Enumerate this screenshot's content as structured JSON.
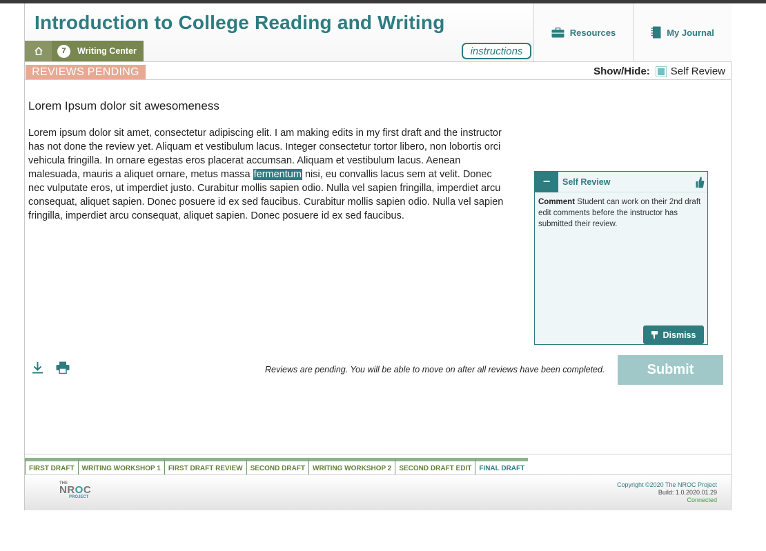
{
  "header": {
    "title": "Introduction to College Reading and Writing",
    "breadcrumb": {
      "step_number": "7",
      "section": "Writing Center"
    },
    "instructions_label": "instructions",
    "resources_label": "Resources",
    "journal_label": "My Journal"
  },
  "status": {
    "badge": "REVIEWS PENDING",
    "show_hide_label": "Show/Hide:",
    "self_review_toggle_label": "Self Review",
    "self_review_checked": true
  },
  "document": {
    "title": "Lorem Ipsum dolor sit awesomeness",
    "body_before": "Lorem ipsum dolor sit amet, consectetur adipiscing elit. I am making edits in my first draft and the instructor has not done the review yet. Aliquam et vestibulum lacus. Integer consectetur tortor libero, non lobortis orci vehicula fringilla. In ornare egestas eros placerat accumsan. Aliquam et vestibulum lacus. Aenean malesuada, mauris a aliquet ornare, metus massa ",
    "highlighted": "fermentum",
    "body_after": " nisi, eu convallis lacus sem at velit. Donec nec vulputate eros, ut imperdiet justo. Curabitur mollis sapien odio. Nulla vel sapien fringilla, imperdiet arcu consequat, aliquet sapien. Donec posuere id ex sed faucibus. Curabitur mollis sapien odio. Nulla vel sapien fringilla, imperdiet arcu consequat, aliquet sapien. Donec posuere id ex sed faucibus."
  },
  "review_card": {
    "collapse_symbol": "−",
    "title": "Self Review",
    "comment_label": "Comment",
    "comment_text": " Student can work on their 2nd draft edit comments before the instructor has submitted their review.",
    "dismiss_label": "Dismiss"
  },
  "actions": {
    "pending_message": "Reviews are pending. You will be able to move on after all reviews have been completed.",
    "submit_label": "Submit",
    "download_icon": "download-icon",
    "print_icon": "print-icon"
  },
  "steps": [
    {
      "label": "FIRST DRAFT"
    },
    {
      "label": "WRITING WORKSHOP 1"
    },
    {
      "label": "FIRST DRAFT REVIEW"
    },
    {
      "label": "SECOND DRAFT"
    },
    {
      "label": "WRITING WORKSHOP 2"
    },
    {
      "label": "SECOND DRAFT EDIT"
    },
    {
      "label": "FINAL DRAFT"
    }
  ],
  "footer": {
    "logo_top": "THE",
    "logo_main_1": "NR",
    "logo_main_o": "O",
    "logo_main_2": "C",
    "logo_sub": "PROJECT",
    "copyright": "Copyright ©2020 The NROC Project",
    "build": "Build: 1.0.2020.01.29",
    "connection": "Connected"
  },
  "colors": {
    "teal": "#2e7c80",
    "olive": "#77874f",
    "salmon": "#e8a993",
    "submit_disabled": "#a1c8c9"
  }
}
